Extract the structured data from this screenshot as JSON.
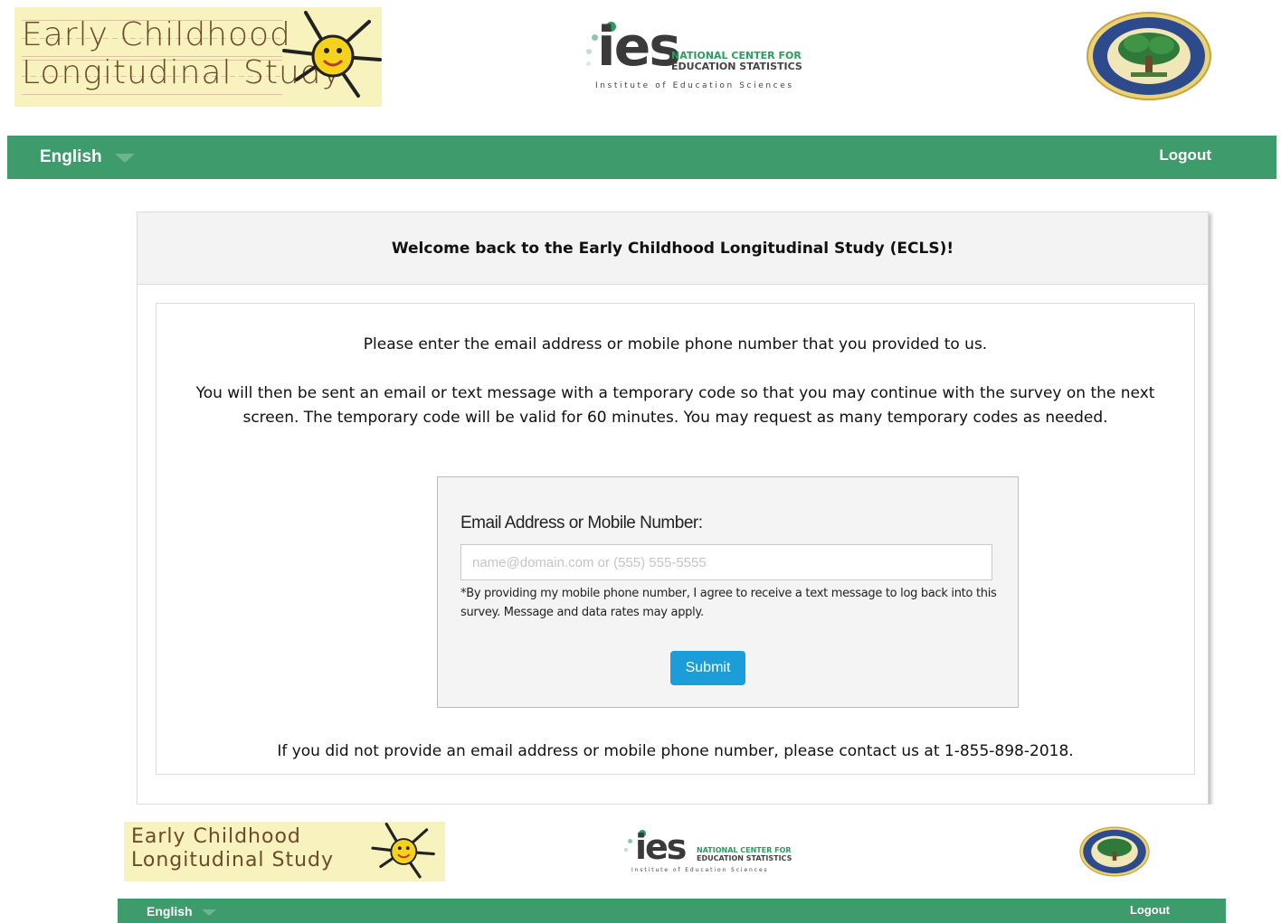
{
  "header": {
    "ecls_logo": {
      "line1": "Early Childhood",
      "line2": "Longitudinal Study"
    },
    "ies_logo": {
      "word": "ies",
      "nces_line1": "NATIONAL CENTER FOR",
      "nces_line2": "EDUCATION STATISTICS",
      "tagline": "Institute of Education Sciences"
    },
    "seal": {
      "name": "department-of-education-seal"
    }
  },
  "nav": {
    "language": "English",
    "logout": "Logout"
  },
  "card": {
    "title": "Welcome back to the Early Childhood Longitudinal Study (ECLS)!",
    "intro": "Please enter the email address or mobile phone number that you provided to us.",
    "instructions": "You will then be sent an email or text message with a temporary code so that you may continue with the survey on the next screen. The temporary code will be valid for 60 minutes. You may request as many temporary codes as needed.",
    "form": {
      "label": "Email Address or Mobile Number:",
      "placeholder": "name@domain.com or (555) 555-5555",
      "value": "",
      "disclaimer": "*By providing my mobile phone number, I agree to receive a text message to log back into this survey. Message and data rates may apply.",
      "submit": "Submit"
    },
    "contact": "If you did not provide an email address or mobile phone number, please contact us at 1-855-898-2018."
  },
  "footer": {
    "ecls_logo": {
      "line1": "Early Childhood",
      "line2": "Longitudinal Study"
    },
    "ies_logo": {
      "word": "ies",
      "nces_line1": "NATIONAL CENTER FOR",
      "nces_line2": "EDUCATION STATISTICS",
      "tagline": "Institute of Education Sciences"
    },
    "language": "English",
    "logout": "Logout"
  },
  "colors": {
    "nav_green": "#3e9b6c",
    "button_blue": "#1a9dd9",
    "logo_yellow": "#f8f2bf",
    "ies_green": "#2a9d5c"
  }
}
